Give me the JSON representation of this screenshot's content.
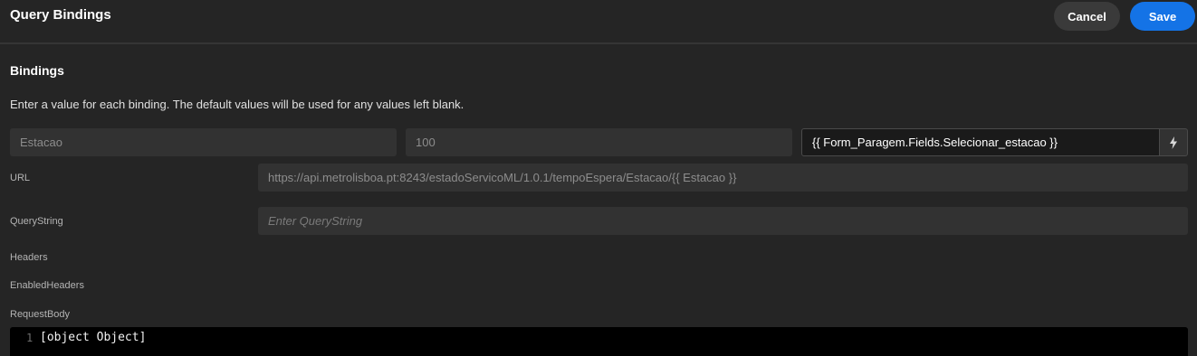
{
  "header": {
    "title": "Query Bindings",
    "cancel_label": "Cancel",
    "save_label": "Save"
  },
  "bindings": {
    "section_title": "Bindings",
    "description": "Enter a value for each binding. The default values will be used for any values left blank.",
    "row": {
      "name_placeholder": "Estacao",
      "default_placeholder": "100",
      "value": "{{ Form_Paragem.Fields.Selecionar_estacao }}",
      "action_icon": "lightning-bolt-icon"
    }
  },
  "fields": {
    "url_label": "URL",
    "url_value": "https://api.metrolisboa.pt:8243/estadoServicoML/1.0.1/tempoEspera/Estacao/{{ Estacao }}",
    "querystring_label": "QueryString",
    "querystring_placeholder": "Enter QueryString",
    "headers_label": "Headers",
    "enabled_headers_label": "EnabledHeaders",
    "request_body_label": "RequestBody"
  },
  "editor": {
    "line_number": "1",
    "code": "[object Object]"
  },
  "colors": {
    "background": "#252525",
    "field_background": "#323232",
    "accent": "#1473e6",
    "editor_background": "#000000"
  }
}
